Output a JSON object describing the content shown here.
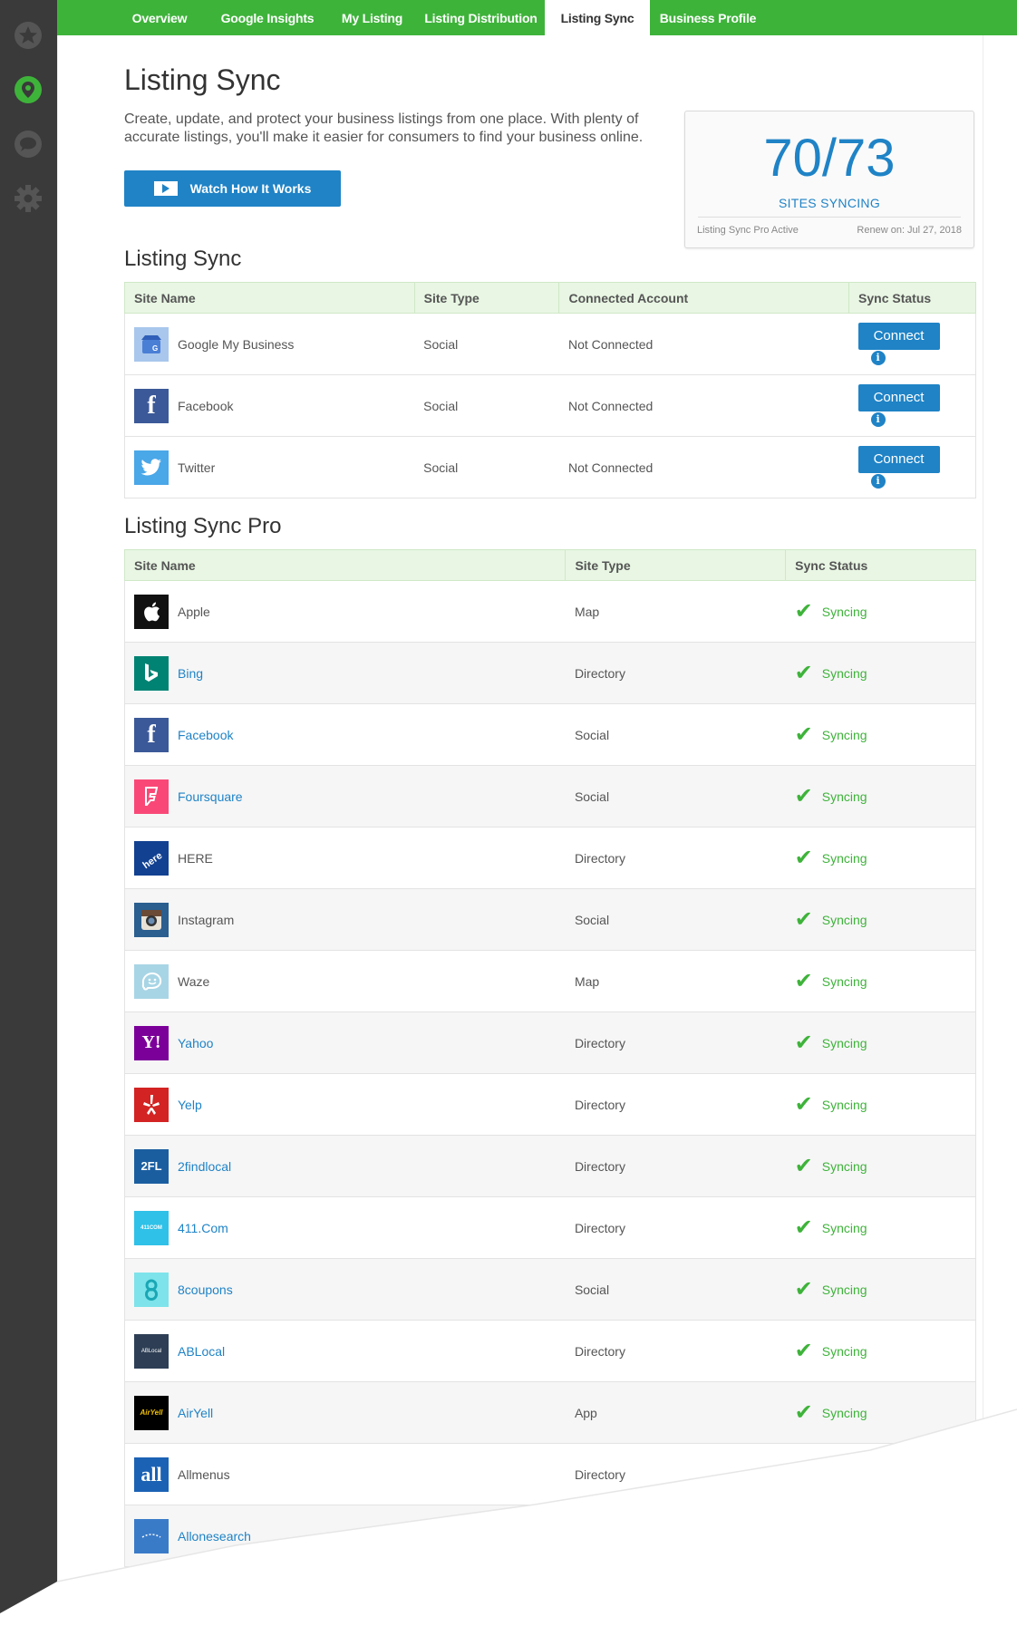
{
  "nav": {
    "tabs": [
      {
        "label": "Overview"
      },
      {
        "label": "Google Insights"
      },
      {
        "label": "My Listing"
      },
      {
        "label": "Listing Distribution"
      },
      {
        "label": "Listing Sync"
      },
      {
        "label": "Business Profile"
      }
    ],
    "active": "Listing Sync"
  },
  "sidebar": {
    "icons": [
      "star-icon",
      "location-pin-icon",
      "chat-icon",
      "gear-icon"
    ]
  },
  "header": {
    "title": "Listing Sync",
    "intro": "Create, update, and protect your business listings from one place. With plenty of accurate listings, you'll make it easier for consumers to find your business online.",
    "watch_button": "Watch How It Works"
  },
  "stats": {
    "count": "70/73",
    "label": "SITES SYNCING",
    "plan": "Listing Sync Pro Active",
    "renew": "Renew on: Jul 27, 2018"
  },
  "listing_sync": {
    "title": "Listing Sync",
    "columns": [
      "Site Name",
      "Site Type",
      "Connected Account",
      "Sync Status"
    ],
    "rows": [
      {
        "name": "Google My Business",
        "type": "Social",
        "account": "Not Connected",
        "action": "Connect"
      },
      {
        "name": "Facebook",
        "type": "Social",
        "account": "Not Connected",
        "action": "Connect"
      },
      {
        "name": "Twitter",
        "type": "Social",
        "account": "Not Connected",
        "action": "Connect"
      }
    ]
  },
  "listing_sync_pro": {
    "title": "Listing Sync Pro",
    "columns": [
      "Site Name",
      "Site Type",
      "Sync Status"
    ],
    "rows": [
      {
        "name": "Apple",
        "type": "Map",
        "status": "Syncing"
      },
      {
        "name": "Bing",
        "type": "Directory",
        "status": "Syncing"
      },
      {
        "name": "Facebook",
        "type": "Social",
        "status": "Syncing"
      },
      {
        "name": "Foursquare",
        "type": "Social",
        "status": "Syncing"
      },
      {
        "name": "HERE",
        "type": "Directory",
        "status": "Syncing"
      },
      {
        "name": "Instagram",
        "type": "Social",
        "status": "Syncing"
      },
      {
        "name": "Waze",
        "type": "Map",
        "status": "Syncing"
      },
      {
        "name": "Yahoo",
        "type": "Directory",
        "status": "Syncing"
      },
      {
        "name": "Yelp",
        "type": "Directory",
        "status": "Syncing"
      },
      {
        "name": "2findlocal",
        "type": "Directory",
        "status": "Syncing"
      },
      {
        "name": "411.Com",
        "type": "Directory",
        "status": "Syncing"
      },
      {
        "name": "8coupons",
        "type": "Social",
        "status": "Syncing"
      },
      {
        "name": "ABLocal",
        "type": "Directory",
        "status": "Syncing"
      },
      {
        "name": "AirYell",
        "type": "App",
        "status": "Syncing"
      },
      {
        "name": "Allmenus",
        "type": "Directory",
        "status": ""
      },
      {
        "name": "Allonesearch",
        "type": "",
        "status": ""
      }
    ]
  },
  "colors": {
    "brand_green": "#3eb33a",
    "link_blue": "#1f83c6",
    "sidebar": "#3a3a3a"
  }
}
